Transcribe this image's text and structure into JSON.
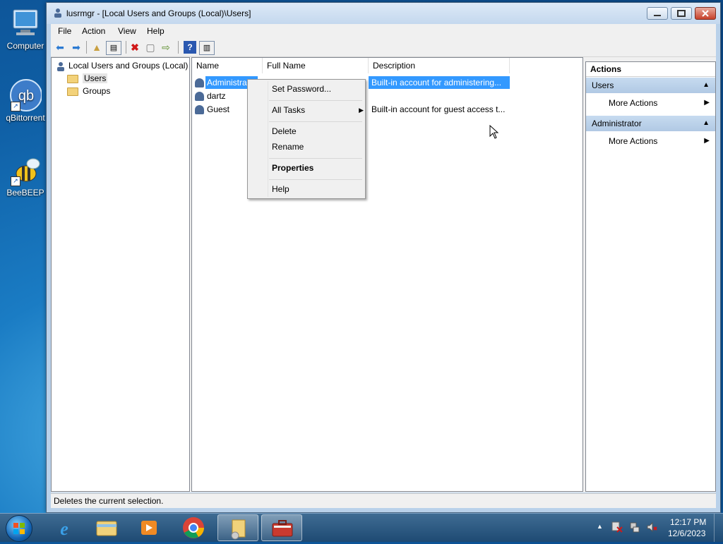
{
  "desktop": {
    "icons": [
      {
        "label": "Computer"
      },
      {
        "label": "qBittorrent"
      },
      {
        "label": "BeeBEEP"
      }
    ]
  },
  "window": {
    "title": "lusrmgr - [Local Users and Groups (Local)\\Users]",
    "menu": [
      "File",
      "Action",
      "View",
      "Help"
    ],
    "tree": {
      "root": "Local Users and Groups (Local)",
      "children": [
        "Users",
        "Groups"
      ]
    },
    "list": {
      "columns": [
        "Name",
        "Full Name",
        "Description"
      ],
      "rows": [
        {
          "name": "Administra",
          "full_name": "",
          "description": "Built-in account for administering..."
        },
        {
          "name": "dartz",
          "full_name": "",
          "description": ""
        },
        {
          "name": "Guest",
          "full_name": "",
          "description": "Built-in account for guest access t..."
        }
      ]
    },
    "actions": {
      "header": "Actions",
      "sections": [
        {
          "title": "Users",
          "items": [
            "More Actions"
          ]
        },
        {
          "title": "Administrator",
          "items": [
            "More Actions"
          ]
        }
      ]
    },
    "status": "Deletes the current selection."
  },
  "context_menu": {
    "items": [
      "Set Password...",
      "All Tasks",
      "Delete",
      "Rename",
      "Properties",
      "Help"
    ]
  },
  "taskbar": {
    "time": "12:17 PM",
    "date": "12/6/2023"
  },
  "colors": {
    "selection": "#3399ff",
    "window_frame": "#b9d1ea",
    "taskbar": "#2a577f"
  }
}
